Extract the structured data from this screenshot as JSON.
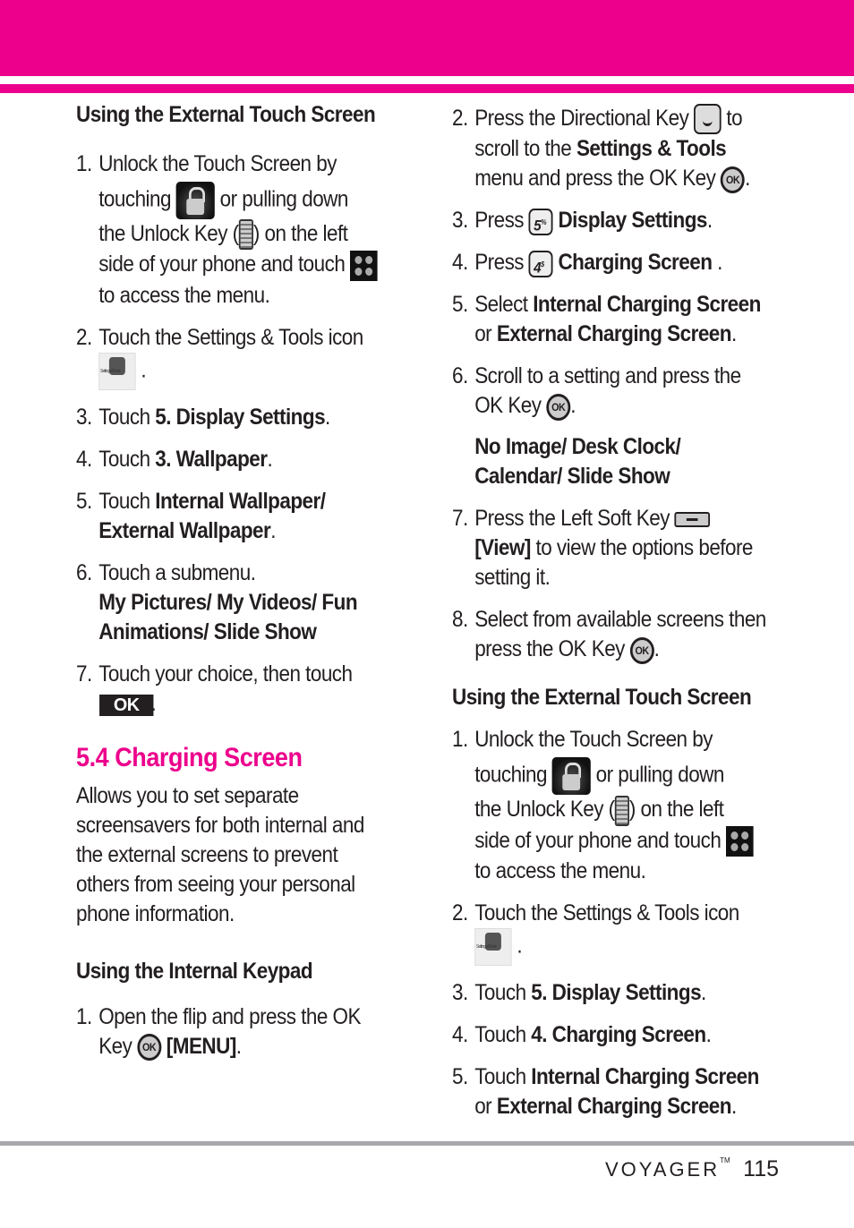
{
  "colors": {
    "accent": "#ec008c",
    "rule": "#a7a9ac",
    "text": "#231f20"
  },
  "left": {
    "heading1": "Using the External Touch Screen",
    "steps1": [
      {
        "n": "1.",
        "a": "Unlock the Touch Screen by",
        "b": "touching",
        "c": "or pulling down",
        "d": "the Unlock Key (",
        "e": ") on the left",
        "f": "side of your phone and touch",
        "g": "to access the menu."
      },
      {
        "n": "2.",
        "a": "Touch the Settings & Tools icon",
        "b": "."
      },
      {
        "n": "3.",
        "a": "Touch ",
        "b": "5. Display Settings",
        "c": "."
      },
      {
        "n": "4.",
        "a": "Touch ",
        "b": "3. Wallpaper",
        "c": "."
      },
      {
        "n": "5.",
        "a": "Touch ",
        "b": "Internal Wallpaper/",
        "c": "External Wallpaper",
        "d": "."
      },
      {
        "n": "6.",
        "a": "Touch a submenu.",
        "b": "My Pictures/ My Videos/ Fun",
        "c": "Animations/ Slide Show"
      },
      {
        "n": "7.",
        "a": "Touch your choice, then touch",
        "b": "OK",
        "c": "."
      }
    ],
    "section_title": "5.4 Charging Screen",
    "section_desc": [
      "Allows you to set separate",
      "screensavers for both internal and",
      "the external screens to prevent",
      "others from seeing your personal",
      "phone information."
    ],
    "heading2": "Using the Internal Keypad",
    "steps2": [
      {
        "n": "1.",
        "a": "Open the flip and press the OK",
        "b": "Key",
        "c": "[MENU]",
        "d": "."
      }
    ]
  },
  "right": {
    "steps1": [
      {
        "n": "2.",
        "a": "Press the Directional Key",
        "b": "to",
        "c": "scroll to the ",
        "d": "Settings & Tools",
        "e": "menu and press the OK Key",
        "f": "."
      },
      {
        "n": "3.",
        "a": "Press",
        "b": "Display Settings",
        "c": ".",
        "key": "5",
        "keysub": "%"
      },
      {
        "n": "4.",
        "a": "Press",
        "b": "Charging Screen",
        "c": " .",
        "key": "4",
        "keysub": "$"
      },
      {
        "n": "5.",
        "a": "Select ",
        "b": "Internal Charging Screen",
        "c": "or ",
        "d": "External Charging Screen",
        "e": "."
      },
      {
        "n": "6.",
        "a": "Scroll to a setting and press the",
        "b": "OK Key",
        "c": ".",
        "d": "No Image/ Desk Clock/",
        "e": "Calendar/ Slide Show"
      },
      {
        "n": "7.",
        "a": "Press the Left Soft Key",
        "b": "[View]",
        "c": " to view the options before",
        "d": "setting it."
      },
      {
        "n": "8.",
        "a": "Select from available screens then",
        "b": "press the OK Key",
        "c": "."
      }
    ],
    "heading": "Using the External Touch Screen",
    "steps2": [
      {
        "n": "1.",
        "a": "Unlock the Touch Screen by",
        "b": "touching",
        "c": "or pulling down",
        "d": "the Unlock Key (",
        "e": ") on the left",
        "f": "side of your phone and touch",
        "g": "to access the menu."
      },
      {
        "n": "2.",
        "a": "Touch the Settings & Tools icon",
        "b": "."
      },
      {
        "n": "3.",
        "a": "Touch ",
        "b": "5. Display Settings",
        "c": "."
      },
      {
        "n": "4.",
        "a": "Touch ",
        "b": "4. Charging Screen",
        "c": "."
      },
      {
        "n": "5.",
        "a": "Touch ",
        "b": "Internal Charging Screen",
        "c": "or ",
        "d": "External Charging Screen",
        "e": "."
      }
    ]
  },
  "icons": {
    "ok_key_label": "OK"
  },
  "footer": {
    "brand": "VOYAGER",
    "tm": "TM",
    "page_number": "115"
  }
}
